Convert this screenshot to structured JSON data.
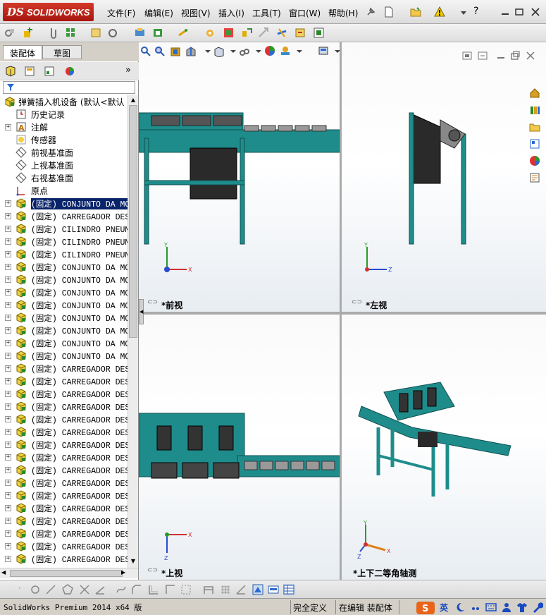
{
  "app": {
    "brand_ds": "DS",
    "brand_name": "SOLIDWORKS"
  },
  "menu": [
    {
      "label": "文件(F)"
    },
    {
      "label": "编辑(E)"
    },
    {
      "label": "视图(V)"
    },
    {
      "label": "插入(I)"
    },
    {
      "label": "工具(T)"
    },
    {
      "label": "窗口(W)"
    },
    {
      "label": "帮助(H)"
    }
  ],
  "tabs": {
    "assembly": "装配体",
    "sketch": "草图"
  },
  "tree": {
    "root": "弹簧插入机设备  (默认<默认",
    "items": [
      {
        "label": "历史记录",
        "icon": "history-icon",
        "expand": ""
      },
      {
        "label": "注解",
        "icon": "annotation-icon",
        "expand": "+"
      },
      {
        "label": "传感器",
        "icon": "sensor-icon",
        "expand": ""
      },
      {
        "label": "前视基准面",
        "icon": "plane-icon",
        "expand": ""
      },
      {
        "label": "上视基准面",
        "icon": "plane-icon",
        "expand": ""
      },
      {
        "label": "右视基准面",
        "icon": "plane-icon",
        "expand": ""
      },
      {
        "label": "原点",
        "icon": "origin-icon",
        "expand": ""
      },
      {
        "label": "(固定) CONJUNTO DA MOLA",
        "icon": "component-icon",
        "expand": "+",
        "selected": true
      },
      {
        "label": "(固定) CARREGADOR DESMC",
        "icon": "component-icon",
        "expand": "+"
      },
      {
        "label": "(固定) CILINDRO PNEUMAT",
        "icon": "component-icon",
        "expand": "+"
      },
      {
        "label": "(固定) CILINDRO PNEUMAT",
        "icon": "component-icon",
        "expand": "+"
      },
      {
        "label": "(固定) CILINDRO PNEUMAT",
        "icon": "component-icon",
        "expand": "+"
      },
      {
        "label": "(固定) CONJUNTO DA MOLA",
        "icon": "component-icon",
        "expand": "+"
      },
      {
        "label": "(固定) CONJUNTO DA MOLA",
        "icon": "component-icon",
        "expand": "+"
      },
      {
        "label": "(固定) CONJUNTO DA MOLA",
        "icon": "component-icon",
        "expand": "+"
      },
      {
        "label": "(固定) CONJUNTO DA MOLA",
        "icon": "component-icon",
        "expand": "+"
      },
      {
        "label": "(固定) CONJUNTO DA MOLA",
        "icon": "component-icon",
        "expand": "+"
      },
      {
        "label": "(固定) CONJUNTO DA MOLA",
        "icon": "component-icon",
        "expand": "+"
      },
      {
        "label": "(固定) CONJUNTO DA MOLA",
        "icon": "component-icon",
        "expand": "+"
      },
      {
        "label": "(固定) CONJUNTO DA MOLA",
        "icon": "component-icon",
        "expand": "+"
      },
      {
        "label": "(固定) CARREGADOR DESMC",
        "icon": "component-icon",
        "expand": "+"
      },
      {
        "label": "(固定) CARREGADOR DESMC",
        "icon": "component-icon",
        "expand": "+"
      },
      {
        "label": "(固定) CARREGADOR DESMC",
        "icon": "component-icon",
        "expand": "+"
      },
      {
        "label": "(固定) CARREGADOR DESMC",
        "icon": "component-icon",
        "expand": "+"
      },
      {
        "label": "(固定) CARREGADOR DESMC",
        "icon": "component-icon",
        "expand": "+"
      },
      {
        "label": "(固定) CARREGADOR DESMC",
        "icon": "component-icon",
        "expand": "+"
      },
      {
        "label": "(固定) CARREGADOR DESMC",
        "icon": "component-icon",
        "expand": "+"
      },
      {
        "label": "(固定) CARREGADOR DESMC",
        "icon": "component-icon",
        "expand": "+"
      },
      {
        "label": "(固定) CARREGADOR DESMC",
        "icon": "component-icon",
        "expand": "+"
      },
      {
        "label": "(固定) CARREGADOR DESMC",
        "icon": "component-icon",
        "expand": "+"
      },
      {
        "label": "(固定) CARREGADOR DESMC",
        "icon": "component-icon",
        "expand": "+"
      },
      {
        "label": "(固定) CARREGADOR DESMC",
        "icon": "component-icon",
        "expand": "+"
      },
      {
        "label": "(固定) CARREGADOR DESMC",
        "icon": "component-icon",
        "expand": "+"
      },
      {
        "label": "(固定) CARREGADOR DESMC",
        "icon": "component-icon",
        "expand": "+"
      },
      {
        "label": "(固定) CARREGADOR DESMC",
        "icon": "component-icon",
        "expand": "+"
      },
      {
        "label": "(固定) CARREGADOR DESMC",
        "icon": "component-icon",
        "expand": "+"
      }
    ]
  },
  "viewports": {
    "front": "*前视",
    "left": "*左视",
    "top": "*上视",
    "iso": "*上下二等角轴测"
  },
  "status": {
    "product": "SolidWorks Premium 2014 x64 版",
    "definition": "完全定义",
    "mode": "在编辑 装配体",
    "ime": "英"
  },
  "colors": {
    "machine": "#1f8c8c",
    "machine_dark": "#0f4f4f",
    "plate": "#2a2a2a",
    "selection": "#0a246a"
  }
}
